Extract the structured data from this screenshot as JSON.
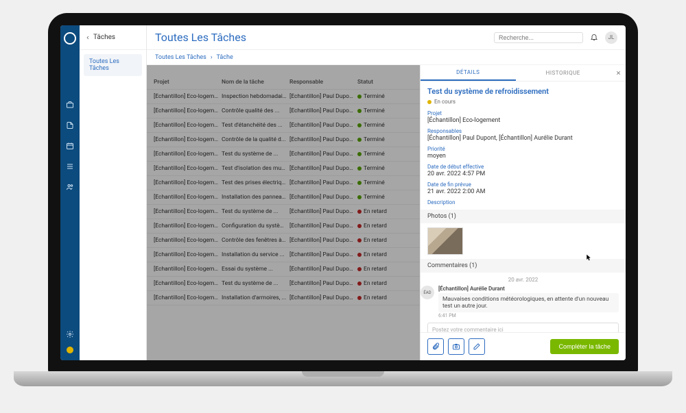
{
  "sub_sidebar": {
    "header": "Tâches",
    "item": "Toutes Les Tâches"
  },
  "topbar": {
    "title": "Toutes Les Tâches",
    "search_placeholder": "Recherche...",
    "avatar_initials": "JL"
  },
  "breadcrumb": {
    "root": "Toutes Les Tâches",
    "sep": "›",
    "current": "Tâche"
  },
  "table": {
    "headers": {
      "project": "Projet",
      "task": "Nom de la tâche",
      "owner": "Responsable",
      "status": "Statut"
    },
    "rows": [
      {
        "project": "[Échantillon] Eco-logement",
        "task": "Inspection hebdomadair...",
        "owner": "[Échantillon] Paul Dupont...",
        "status": "Terminé",
        "color": "green"
      },
      {
        "project": "[Échantillon] Eco-logement",
        "task": "Contrôle qualité des ...",
        "owner": "[Échantillon] Paul Dupont...",
        "status": "Terminé",
        "color": "green"
      },
      {
        "project": "[Échantillon] Eco-logement",
        "task": "Test d'étanchéité des ...",
        "owner": "[Échantillon] Paul Dupont...",
        "status": "Terminé",
        "color": "green"
      },
      {
        "project": "[Échantillon] Eco-logement",
        "task": "Contrôle de la qualité d...",
        "owner": "[Échantillon] Paul Dupont...",
        "status": "Terminé",
        "color": "green"
      },
      {
        "project": "[Échantillon] Eco-logement",
        "task": "Test du système de ...",
        "owner": "[Échantillon] Paul Dupont...",
        "status": "Terminé",
        "color": "green"
      },
      {
        "project": "[Échantillon] Eco-logement",
        "task": "Test d'isolation des murs...",
        "owner": "[Échantillon] Paul Dupont...",
        "status": "Terminé",
        "color": "green"
      },
      {
        "project": "[Échantillon] Eco-logement",
        "task": "Test des prises électriqu...",
        "owner": "[Échantillon] Paul Dupont...",
        "status": "Terminé",
        "color": "green"
      },
      {
        "project": "[Échantillon] Eco-logement",
        "task": "Installation des panneau...",
        "owner": "[Échantillon] Paul Dupont...",
        "status": "Terminé",
        "color": "green"
      },
      {
        "project": "[Échantillon] Eco-logement",
        "task": "Test du système de ...",
        "owner": "[Échantillon] Paul Dupont...",
        "status": "En retard",
        "color": "red"
      },
      {
        "project": "[Échantillon] Eco-logement",
        "task": "Configuration du systèm...",
        "owner": "[Échantillon] Paul Dupont...",
        "status": "En retard",
        "color": "red"
      },
      {
        "project": "[Échantillon] Eco-logement",
        "task": "Contrôle des fenêtres à ...",
        "owner": "[Échantillon] Paul Dupont...",
        "status": "En retard",
        "color": "red"
      },
      {
        "project": "[Échantillon] Eco-logement",
        "task": "Installation du service ...",
        "owner": "[Échantillon] Paul Dupont...",
        "status": "En retard",
        "color": "red"
      },
      {
        "project": "[Échantillon] Eco-logement",
        "task": "Essai du système ...",
        "owner": "[Échantillon] Paul Dupont...",
        "status": "En retard",
        "color": "red"
      },
      {
        "project": "[Échantillon] Eco-logement",
        "task": "Test du système de ...",
        "owner": "[Échantillon] Paul Dupont...",
        "status": "En retard",
        "color": "red"
      },
      {
        "project": "[Échantillon] Eco-logement",
        "task": "Installation d'armoires, ...",
        "owner": "[Échantillon] Paul Dupont...",
        "status": "En retard",
        "color": "red"
      }
    ]
  },
  "detail": {
    "tabs": {
      "details": "DÉTAILS",
      "history": "HISTORIQUE"
    },
    "title": "Test du système de refroidissement",
    "status": "En cours",
    "fields": {
      "project_label": "Projet",
      "project_value": "[Échantillon] Eco-logement",
      "owners_label": "Responsables",
      "owners_value": "[Échantillon] Paul Dupont, [Échantillon] Aurélie Durant",
      "priority_label": "Priorité",
      "priority_value": "moyen",
      "start_label": "Date de début effective",
      "start_value": "20 avr. 2022 4:57 PM",
      "end_label": "Date de fin prévue",
      "end_value": "21 avr. 2022 2:00 AM",
      "desc_label": "Description"
    },
    "photos_header": "Photos (1)",
    "comments_header": "Commentaires (1)",
    "comment_date": "20 avr. 2022",
    "comment": {
      "avatar": "ÉAD",
      "author": "[Échantillon] Aurélie Durant",
      "text": "Mauvaises conditions météorologiques, en attente d'un nouveau test un autre jour.",
      "time": "6:41 PM"
    },
    "comment_placeholder": "Postez votre commentaire ici",
    "complete_btn": "Compléter la tâche"
  }
}
